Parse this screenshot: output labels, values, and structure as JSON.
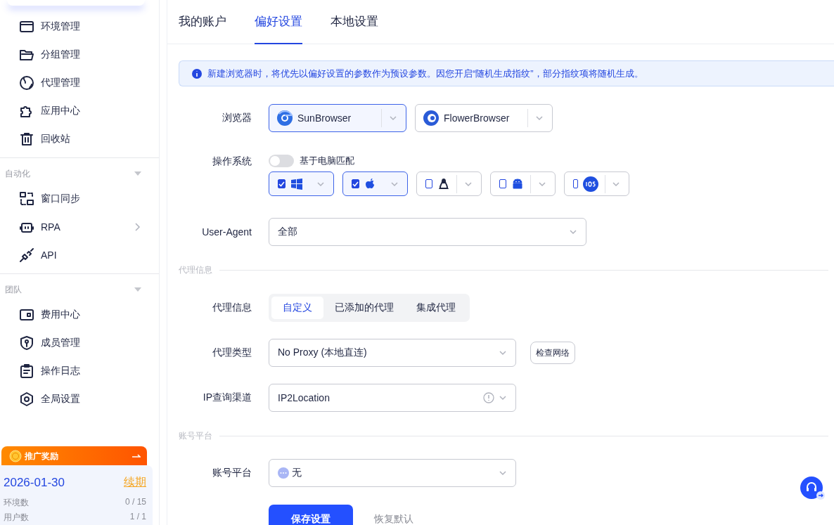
{
  "sidebar": {
    "groups": [
      {
        "items": [
          {
            "label": "环境管理",
            "submenu": false
          },
          {
            "label": "分组管理",
            "submenu": false
          },
          {
            "label": "代理管理",
            "submenu": false
          },
          {
            "label": "应用中心",
            "submenu": false
          },
          {
            "label": "回收站",
            "submenu": false
          }
        ]
      },
      {
        "title": "自动化",
        "expanded": true,
        "items": [
          {
            "label": "窗口同步",
            "submenu": false
          },
          {
            "label": "RPA",
            "submenu": true
          },
          {
            "label": "API",
            "submenu": false
          }
        ]
      },
      {
        "title": "团队",
        "expanded": true,
        "items": [
          {
            "label": "费用中心",
            "submenu": false
          },
          {
            "label": "成员管理",
            "submenu": false
          },
          {
            "label": "操作日志",
            "submenu": false
          },
          {
            "label": "全局设置",
            "submenu": false
          }
        ]
      }
    ],
    "promo": {
      "title": "推广奖励"
    },
    "plan": {
      "expiry": "2026-01-30",
      "renew": "续期",
      "stats": [
        {
          "label": "环境数",
          "value": "0 / 15"
        },
        {
          "label": "用户数",
          "value": "1 / 1"
        }
      ]
    }
  },
  "tabs": [
    {
      "label": "我的账户",
      "selected": false
    },
    {
      "label": "偏好设置",
      "selected": true
    },
    {
      "label": "本地设置",
      "selected": false
    }
  ],
  "notice": "新建浏览器时，将优先以偏好设置的参数作为预设参数。因您开启“随机生成指纹”，部分指纹项将随机生成。",
  "form": {
    "browser": {
      "label": "浏览器",
      "options": [
        {
          "name": "SunBrowser",
          "selected": true
        },
        {
          "name": "FlowerBrowser",
          "selected": false
        }
      ]
    },
    "os": {
      "label": "操作系统",
      "toggle": {
        "label": "基于电脑匹配",
        "on": false
      },
      "options": [
        {
          "checked": true
        },
        {
          "checked": true
        },
        {
          "checked": false
        },
        {
          "checked": false
        },
        {
          "checked": false
        }
      ]
    },
    "user_agent": {
      "label": "User-Agent",
      "value": "全部"
    },
    "proxy_section": "代理信息",
    "proxy_info": {
      "label": "代理信息",
      "options": [
        {
          "label": "自定义",
          "selected": true
        },
        {
          "label": "已添加的代理",
          "selected": false
        },
        {
          "label": "集成代理",
          "selected": false
        }
      ]
    },
    "proxy_type": {
      "label": "代理类型",
      "value": "No Proxy (本地直连)",
      "button": "检查网络"
    },
    "ip_channel": {
      "label": "IP查询渠道",
      "value": "IP2Location"
    },
    "account_section": "账号平台",
    "account_platform": {
      "label": "账号平台",
      "value": "无"
    }
  },
  "buttons": [
    {
      "label": "保存设置",
      "kind": "primary"
    },
    {
      "label": "恢复默认",
      "kind": "text"
    }
  ]
}
